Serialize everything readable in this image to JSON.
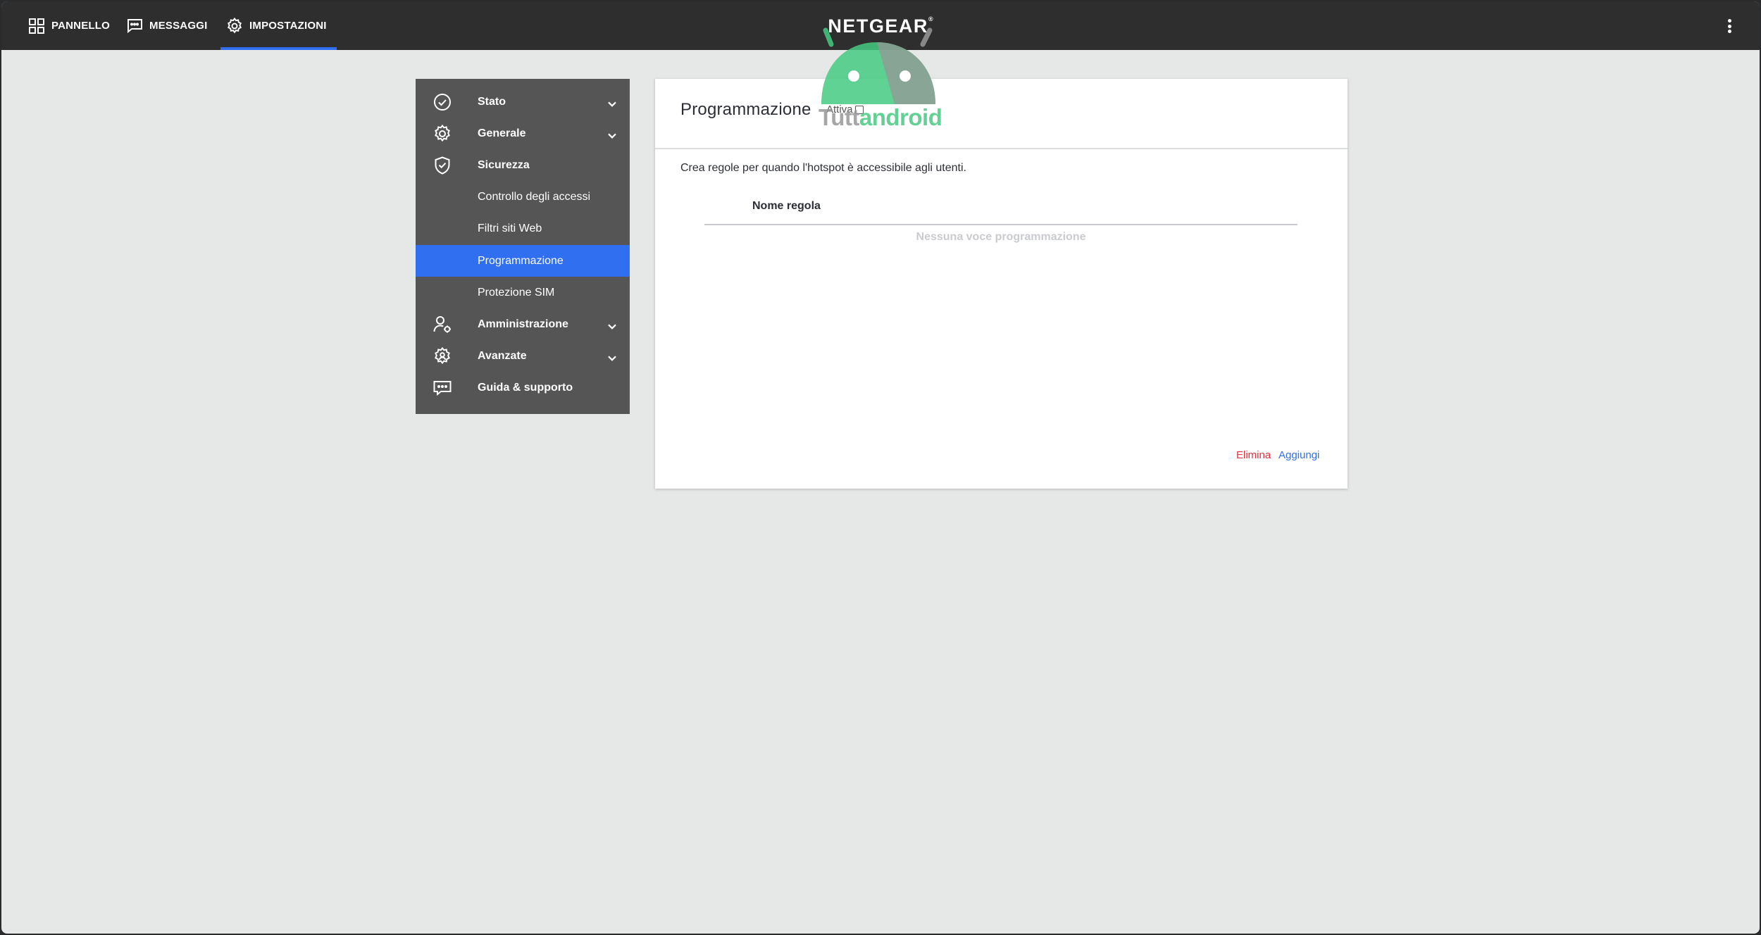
{
  "topbar": {
    "tabs": [
      {
        "label": "PANNELLO",
        "icon": "dashboard-grid-icon"
      },
      {
        "label": "MESSAGGI",
        "icon": "message-icon"
      },
      {
        "label": "IMPOSTAZIONI",
        "icon": "gear-icon",
        "active": true
      }
    ],
    "brand": "NETGEAR",
    "brand_mark": "®",
    "menu_icon": "kebab-menu-icon"
  },
  "sidebar": {
    "items": [
      {
        "label": "Stato",
        "icon": "check-circle-icon",
        "expandable": true
      },
      {
        "label": "Generale",
        "icon": "gear-icon",
        "expandable": true
      },
      {
        "label": "Sicurezza",
        "icon": "shield-check-icon",
        "expandable": false
      },
      {
        "label": "Controllo degli accessi"
      },
      {
        "label": "Filtri siti Web"
      },
      {
        "label": "Programmazione",
        "active": true
      },
      {
        "label": "Protezione SIM"
      },
      {
        "label": "Amministrazione",
        "icon": "user-gear-icon",
        "expandable": true
      },
      {
        "label": "Avanzate",
        "icon": "advanced-settings-icon",
        "expandable": true
      },
      {
        "label": "Guida & supporto",
        "icon": "chat-help-icon",
        "expandable": false
      }
    ]
  },
  "card": {
    "title": "Programmazione",
    "enable_label": "Attiva",
    "enable_checked": false,
    "description": "Crea regole per quando l'hotspot è accessibile agli utenti.",
    "table": {
      "columns": [
        "Nome regola"
      ],
      "empty_text": "Nessuna voce programmazione"
    },
    "actions": {
      "delete": "Elimina",
      "add": "Aggiungi"
    }
  },
  "watermark": {
    "part1": "Tutt",
    "part2": "android"
  },
  "colors": {
    "topbar_bg": "#2e2e2e",
    "page_bg": "#e6e8e7",
    "sidebar_bg": "#555555",
    "accent": "#2f6ff0",
    "delete": "#e5323b",
    "watermark_green": "#44ca80"
  }
}
